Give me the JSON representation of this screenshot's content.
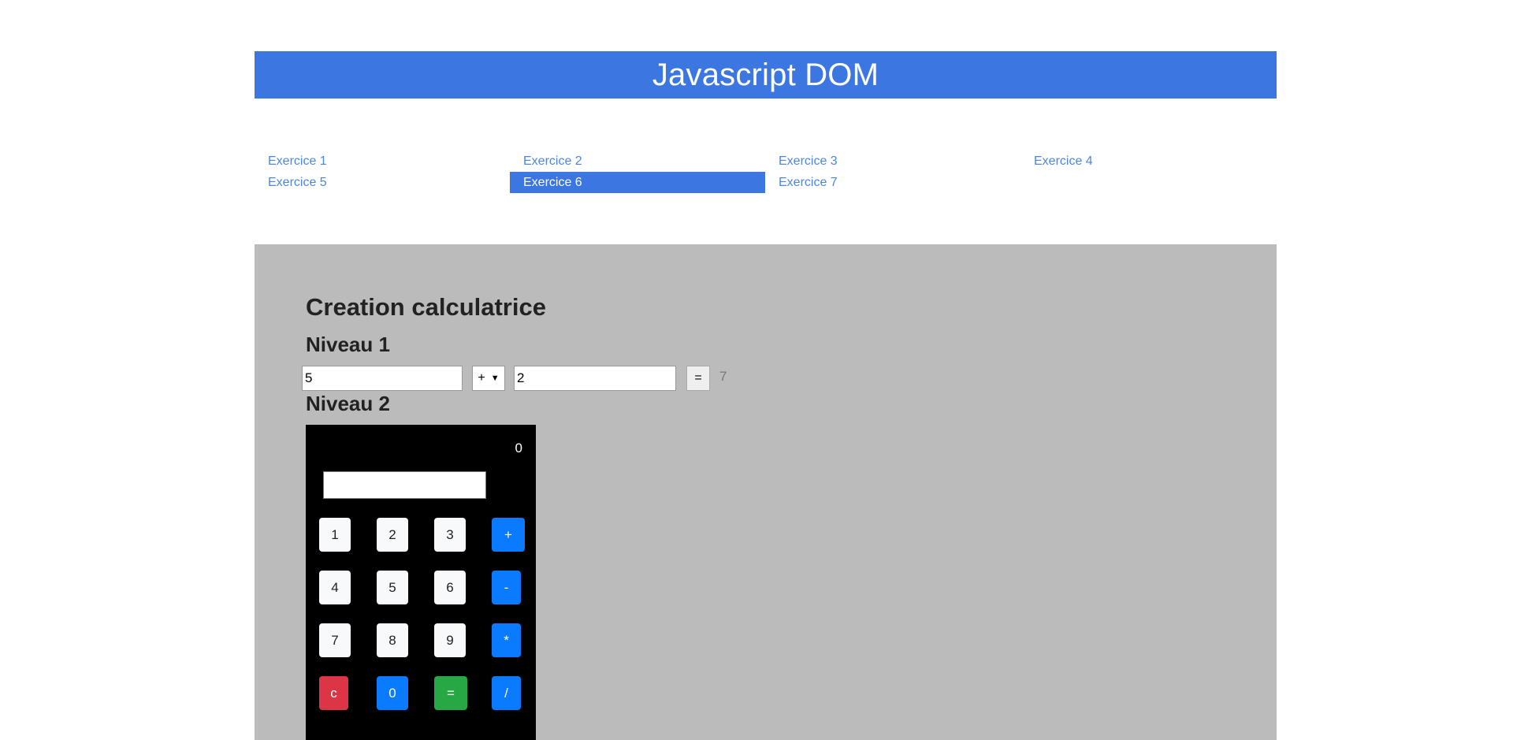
{
  "header": {
    "title": "Javascript DOM"
  },
  "nav": {
    "items": [
      {
        "label": "Exercice 1",
        "active": false
      },
      {
        "label": "Exercice 2",
        "active": false
      },
      {
        "label": "Exercice 3",
        "active": false
      },
      {
        "label": "Exercice 4",
        "active": false
      },
      {
        "label": "Exercice 5",
        "active": false
      },
      {
        "label": "Exercice 6",
        "active": true
      },
      {
        "label": "Exercice 7",
        "active": false
      }
    ]
  },
  "main": {
    "title": "Creation calculatrice",
    "level1": {
      "heading": "Niveau 1",
      "operand_a": "5",
      "operator": "+",
      "operand_b": "2",
      "equals_label": "=",
      "result": "7"
    },
    "level2": {
      "heading": "Niveau 2",
      "display": "0",
      "input_value": "",
      "keys": [
        [
          "1",
          "2",
          "3",
          "+"
        ],
        [
          "4",
          "5",
          "6",
          "-"
        ],
        [
          "7",
          "8",
          "9",
          "*"
        ],
        [
          "c",
          "0",
          "=",
          "/"
        ]
      ]
    }
  },
  "colors": {
    "banner": "#3b76e1",
    "link": "#4c86e8",
    "panel": "#bbbbbb",
    "calc_bg": "#000000",
    "op_key": "#0a7bff",
    "clear_key": "#dc3545",
    "equals_key": "#28a745"
  }
}
